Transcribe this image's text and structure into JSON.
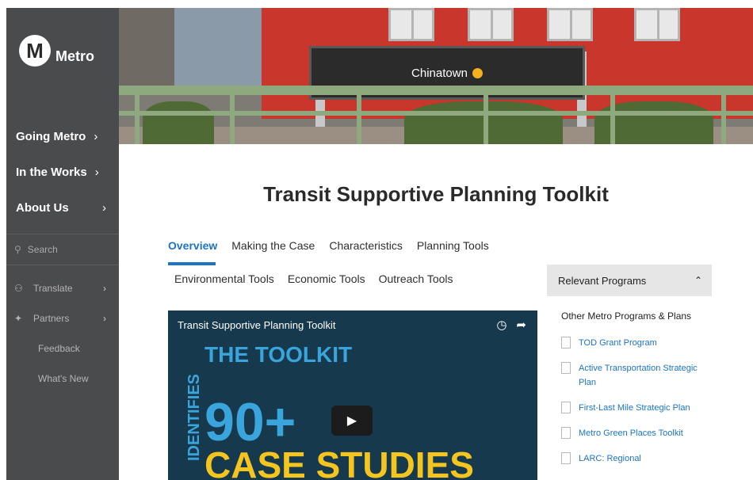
{
  "sidebar": {
    "logo_letter": "M",
    "logo_text": "Metro",
    "nav": [
      {
        "label": "Going Metro",
        "chev": "›"
      },
      {
        "label": "In the Works",
        "chev": "›"
      },
      {
        "label": "About Us",
        "chev": "›"
      }
    ],
    "search_placeholder": "Search",
    "sub": [
      {
        "label": "Translate",
        "icon": "translate-icon",
        "chev": "›"
      },
      {
        "label": "Partners",
        "icon": "partners-icon",
        "chev": "›"
      },
      {
        "label": "Feedback"
      },
      {
        "label": "What's New"
      }
    ]
  },
  "hero": {
    "sign_text": "Chinatown",
    "accent": "#f5b21c"
  },
  "main": {
    "title": "Transit Supportive Planning Toolkit",
    "tabs_row1": [
      "Overview",
      "Making the Case",
      "Characteristics",
      "Planning Tools"
    ],
    "tabs_row2": [
      "Environmental Tools",
      "Economic Tools",
      "Outreach Tools"
    ],
    "active_tab": "Overview"
  },
  "video": {
    "title": "Transit Supportive Planning Toolkit",
    "line1": "THE TOOLKIT",
    "vertical": "IDENTIFIES",
    "big": "90+",
    "bottom": "CASE STUDIES"
  },
  "panel": {
    "heading": "Relevant Programs",
    "subheading": "Other Metro Programs & Plans",
    "items": [
      "TOD Grant Program",
      "Active Transportation Strategic Plan",
      "First-Last Mile Strategic Plan",
      "Metro Green Places Toolkit",
      "LARC: Regional"
    ]
  },
  "colors": {
    "link": "#1c74c4",
    "sidebar": "#4a4b4d"
  }
}
